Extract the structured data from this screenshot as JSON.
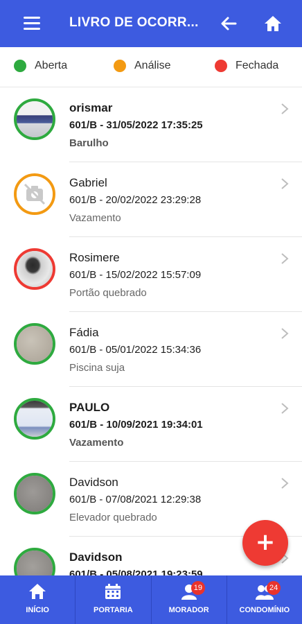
{
  "appbar": {
    "title": "LIVRO DE OCORR...",
    "menu_icon": "menu-icon",
    "back_icon": "arrow-left-icon",
    "home_icon": "home-icon"
  },
  "legend": [
    {
      "label": "Aberta",
      "color": "#2eaa3f"
    },
    {
      "label": "Análise",
      "color": "#f39a12"
    },
    {
      "label": "Fechada",
      "color": "#ee3a33"
    }
  ],
  "items": [
    {
      "name": "orismar",
      "meta": "601/B - 31/05/2022 17:35:25",
      "desc": "Barulho",
      "status": "Aberta",
      "status_color": "#2eaa3f",
      "unread": true
    },
    {
      "name": "Gabriel",
      "meta": "601/B - 20/02/2022 23:29:28",
      "desc": "Vazamento",
      "status": "Análise",
      "status_color": "#f39a12",
      "unread": false
    },
    {
      "name": "Rosimere",
      "meta": "601/B - 15/02/2022 15:57:09",
      "desc": "Portão quebrado",
      "status": "Fechada",
      "status_color": "#ee3a33",
      "unread": false
    },
    {
      "name": "Fádia",
      "meta": "601/B - 05/01/2022 15:34:36",
      "desc": "Piscina suja",
      "status": "Aberta",
      "status_color": "#2eaa3f",
      "unread": false
    },
    {
      "name": "PAULO",
      "meta": "601/B - 10/09/2021 19:34:01",
      "desc": "Vazamento",
      "status": "Aberta",
      "status_color": "#2eaa3f",
      "unread": true
    },
    {
      "name": "Davidson",
      "meta": "601/B - 07/08/2021 12:29:38",
      "desc": "Elevador quebrado",
      "status": "Aberta",
      "status_color": "#2eaa3f",
      "unread": false
    },
    {
      "name": "Davidson",
      "meta": "601/B - 05/08/2021 19:23:59",
      "desc": "",
      "status": "Aberta",
      "status_color": "#2eaa3f",
      "unread": true
    }
  ],
  "fab": {
    "label": "+"
  },
  "bottom_nav": [
    {
      "label": "INÍCIO",
      "icon": "home-icon",
      "badge": ""
    },
    {
      "label": "PORTARIA",
      "icon": "calendar-icon",
      "badge": ""
    },
    {
      "label": "MORADOR",
      "icon": "person-icon",
      "badge": "19"
    },
    {
      "label": "CONDOMÍNIO",
      "icon": "people-group-icon",
      "badge": "24"
    }
  ],
  "colors": {
    "primary": "#3d5be0",
    "accent": "#ee3a33"
  }
}
